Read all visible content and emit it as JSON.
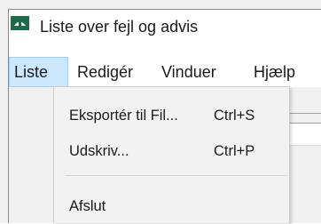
{
  "window": {
    "title": "Liste over fejl og advis",
    "icon": "app-icon",
    "accent_color": "#1d6b4b"
  },
  "menubar": {
    "items": [
      {
        "label": "Liste",
        "active": true
      },
      {
        "label": "Redigér",
        "active": false
      },
      {
        "label": "Vinduer",
        "active": false
      },
      {
        "label": "Hjælp",
        "active": false
      }
    ],
    "active_color": "#cce8ff"
  },
  "dropdown": {
    "items": [
      {
        "label": "Eksportér til Fil...",
        "shortcut": "Ctrl+S"
      },
      {
        "label": "Udskriv...",
        "shortcut": "Ctrl+P"
      },
      {
        "label": "Afslut",
        "shortcut": ""
      }
    ]
  }
}
